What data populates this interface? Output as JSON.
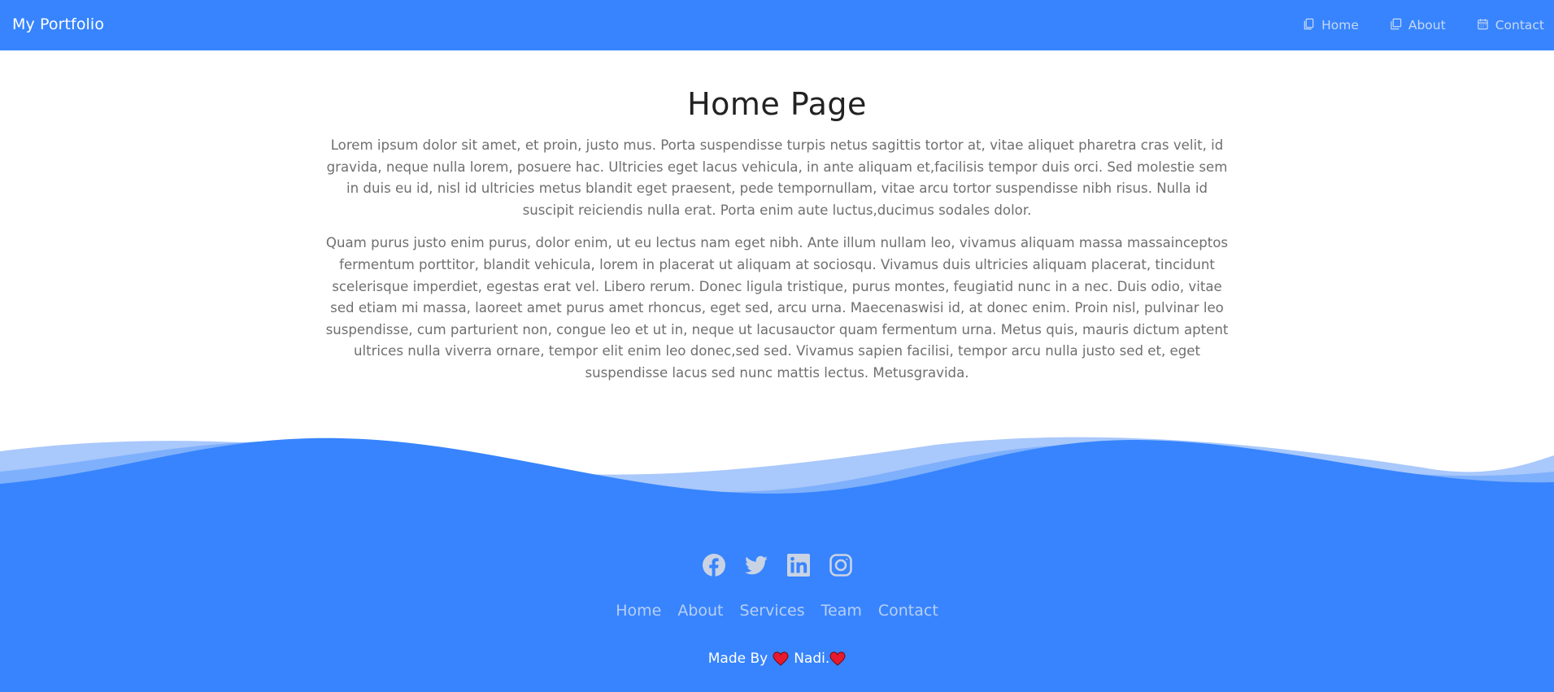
{
  "navbar": {
    "brand": "My Portfolio",
    "links": [
      {
        "label": "Home",
        "icon": "document-icon"
      },
      {
        "label": "About",
        "icon": "copy-icon"
      },
      {
        "label": "Contact",
        "icon": "calendar-icon"
      }
    ]
  },
  "main": {
    "title": "Home Page",
    "paragraphs": [
      "Lorem ipsum dolor sit amet, et proin, justo mus. Porta suspendisse turpis netus sagittis tortor at, vitae aliquet pharetra cras velit, id gravida, neque nulla lorem, posuere hac. Ultricies eget lacus vehicula, in ante aliquam et,facilisis tempor duis orci. Sed molestie sem in duis eu id, nisl id ultricies metus blandit eget praesent, pede tempornullam, vitae arcu tortor suspendisse nibh risus. Nulla id suscipit reiciendis nulla erat. Porta enim aute luctus,ducimus sodales dolor.",
      "Quam purus justo enim purus, dolor enim, ut eu lectus nam eget nibh. Ante illum nullam leo, vivamus aliquam massa massainceptos fermentum porttitor, blandit vehicula, lorem in placerat ut aliquam at sociosqu. Vivamus duis ultricies aliquam placerat, tincidunt scelerisque imperdiet, egestas erat vel. Libero rerum. Donec ligula tristique, purus montes, feugiatid nunc in a nec. Duis odio, vitae sed etiam mi massa, laoreet amet purus amet rhoncus, eget sed, arcu urna. Maecenaswisi id, at donec enim. Proin nisl, pulvinar leo suspendisse, cum parturient non, congue leo et ut in, neque ut lacusauctor quam fermentum urna. Metus quis, mauris dictum aptent ultrices nulla viverra ornare, tempor elit enim leo donec,sed sed. Vivamus sapien facilisi, tempor arcu nulla justo sed et, eget suspendisse lacus sed nunc mattis lectus. Metusgravida."
    ]
  },
  "footer": {
    "social": [
      "facebook-icon",
      "twitter-icon",
      "linkedin-icon",
      "instagram-icon"
    ],
    "menu": [
      "Home",
      "About",
      "Services",
      "Team",
      "Contact"
    ],
    "credit_prefix": "Made By",
    "credit_name": "Nadi."
  },
  "colors": {
    "primary": "#3784fe",
    "nav_link": "#c7d8f4",
    "footer_link": "#b8cff5",
    "heart": "#e8192c"
  }
}
